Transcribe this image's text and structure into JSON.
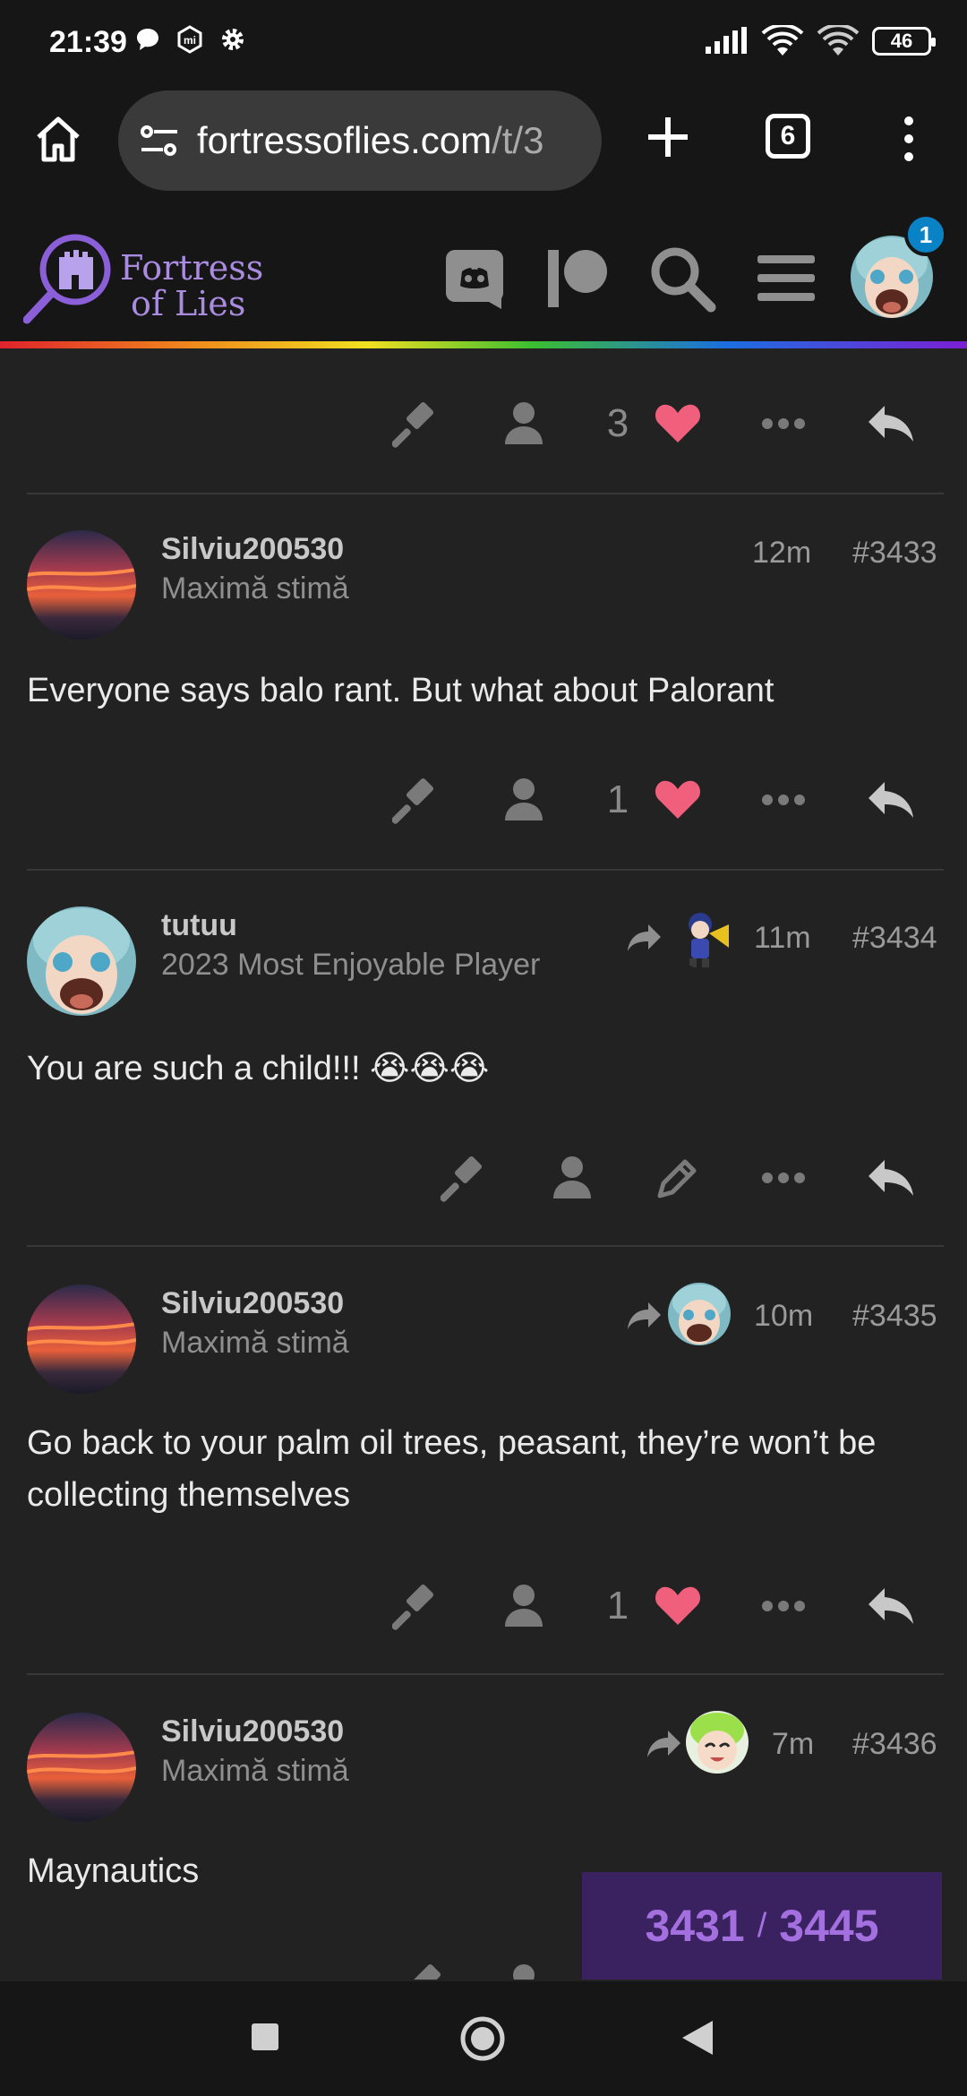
{
  "status_bar": {
    "time": "21:39",
    "battery": "46",
    "icons": [
      "chat-icon",
      "mi-icon",
      "gear-icon",
      "signal-icon",
      "wifi-icon",
      "wifi-call-icon",
      "battery-icon"
    ]
  },
  "browser": {
    "domain": "fortressoflies.com",
    "path": "/t/3",
    "tab_count": "6"
  },
  "site": {
    "logo_line1": "Fortress",
    "logo_line2": "of Lies",
    "notification_count": "1",
    "accent_color": "#a98be0"
  },
  "top_actions": {
    "like_count": "3"
  },
  "posts": [
    {
      "username": "Silviu200530",
      "title": "Maximă stimă",
      "time": "12m",
      "number": "#3433",
      "body": "Everyone says balo rant. But what about Palorant",
      "like_count": "1",
      "avatar": "sunset"
    },
    {
      "username": "tutuu",
      "title": "2023 Most Enjoyable Player",
      "time": "11m",
      "number": "#3434",
      "body": "You are such a child!!! 😭😭😭",
      "avatar": "anime-screaming"
    },
    {
      "username": "Silviu200530",
      "title": "Maximă stimă",
      "time": "10m",
      "number": "#3435",
      "body": "Go back to your palm oil trees, peasant, they’re won’t be collecting themselves",
      "like_count": "1",
      "avatar": "sunset"
    },
    {
      "username": "Silviu200530",
      "title": "Maximă stimă",
      "time": "7m",
      "number": "#3436",
      "body": "Maynautics",
      "avatar": "sunset"
    }
  ],
  "progress": {
    "current": "3431",
    "separator": "/",
    "total": "3445"
  },
  "colors": {
    "like": "#f0607c",
    "background": "#222222",
    "header": "#161616",
    "progress_bg": "#3a2260",
    "progress_text": "#a470e0"
  }
}
